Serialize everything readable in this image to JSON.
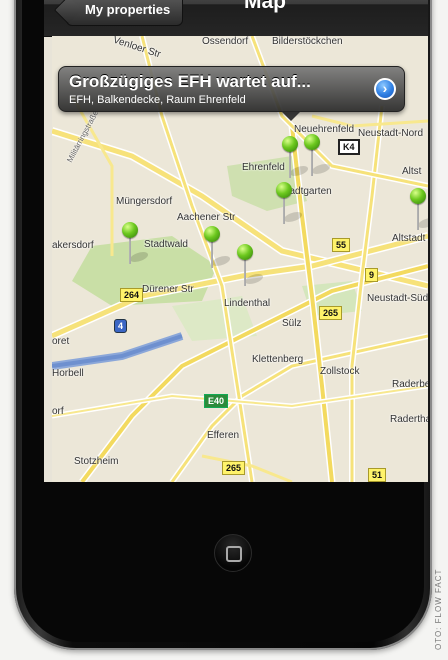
{
  "navbar": {
    "back_label": "My properties",
    "title": "Map"
  },
  "callout": {
    "title": "Großzügiges EFH wartet auf...",
    "subtitle": "EFH, Balkendecke, Raum Ehrenfeld",
    "disclosure_icon": "chevron-right-icon"
  },
  "map_labels": {
    "ossendorf": "Ossendorf",
    "bilderstoeckchen": "Bilderstöckchen",
    "venloer": "Venloer Str",
    "ehrenfeld": "Ehrenfeld",
    "neuehrenfeld": "Neuehrenfeld",
    "neustadt_nord": "Neustadt-Nord",
    "altstadt": "Altst",
    "stadtgarten": "Stadtgarten",
    "muengersdorf": "Müngersdorf",
    "aachener": "Aachener Str",
    "bakersdorf": "akersdorf",
    "stadtwald": "Stadtwald",
    "altstadt_sud": "Altstadt",
    "dueren": "Dürener Str",
    "lindenthal": "Lindenthal",
    "neustadt_sued": "Neustadt-Süd",
    "suelz": "Sülz",
    "klettenberg": "Klettenberg",
    "zollstock": "Zollstock",
    "raderberg": "Raderbe",
    "horbell": "Horbell",
    "raderthal": "Raderthal",
    "efferen": "Efferen",
    "stotzheim": "Stotzheim",
    "dorf": "orf",
    "oret": "oret",
    "militaerring": "Militärringstraße"
  },
  "road_shields": {
    "k4": "K4",
    "r55": "55",
    "r9": "9",
    "r264": "264",
    "r265a": "265",
    "r265b": "265",
    "r51": "51",
    "a4": "4",
    "e40": "E40"
  },
  "pins_count": 7,
  "credit": "OTO: FLOW FACT",
  "colors": {
    "pin": "#6cc81e",
    "callout_bg": "#3a3a3a",
    "navbar": "#2a2a2a",
    "disclosure": "#2f7fe3"
  }
}
